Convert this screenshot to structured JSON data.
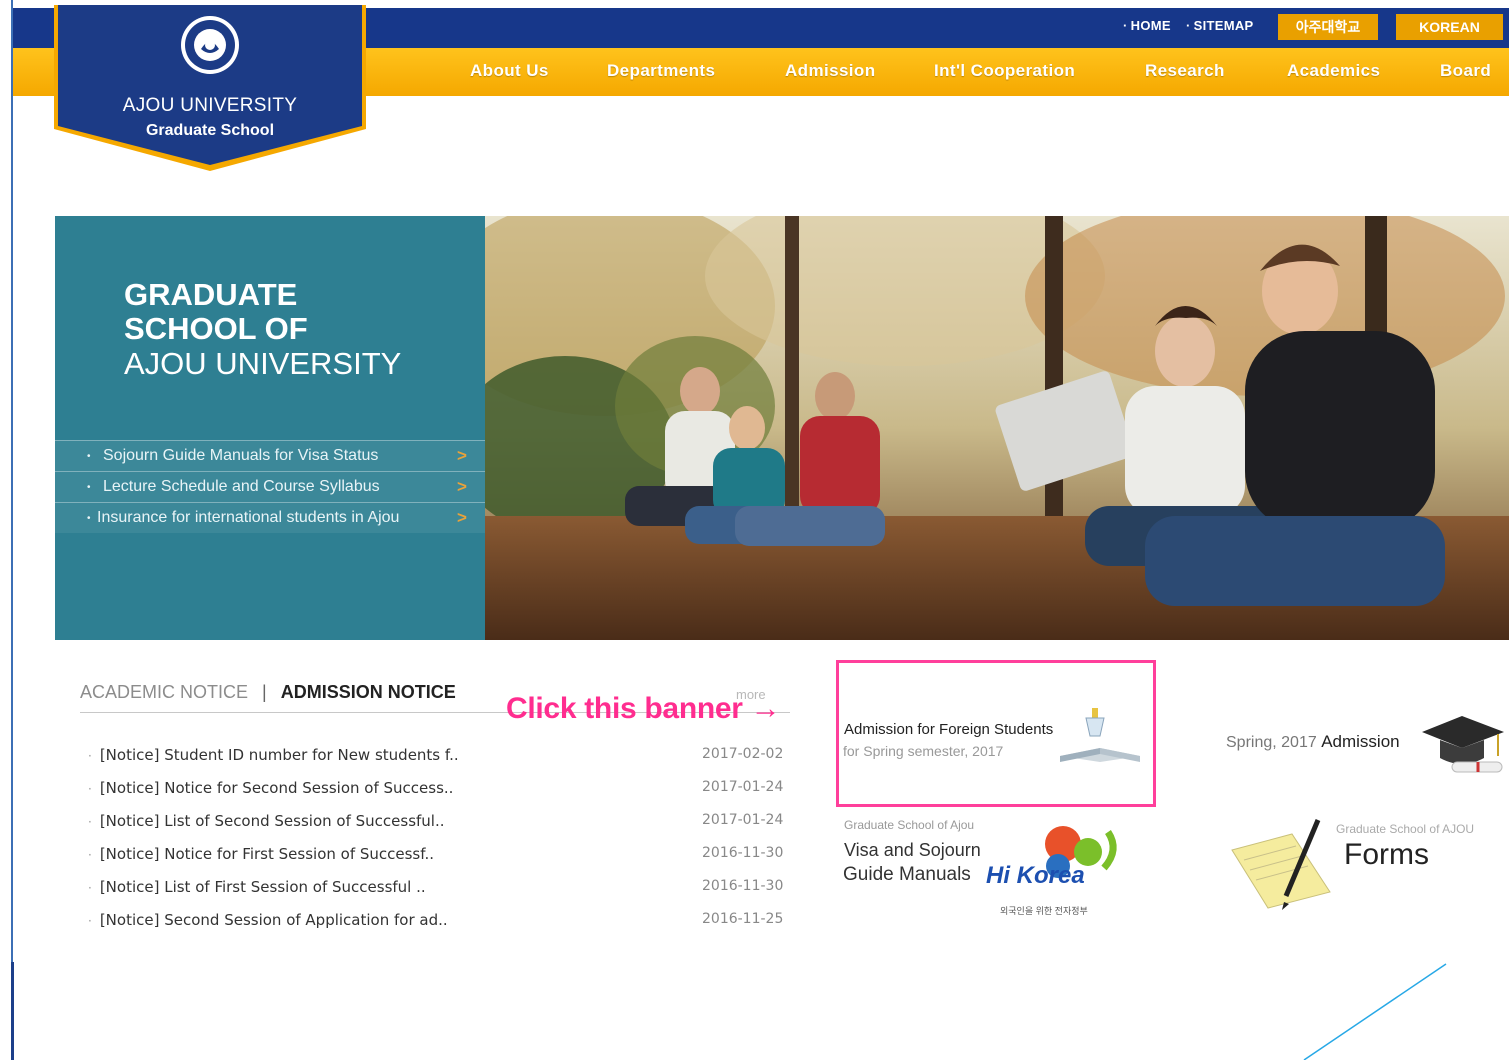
{
  "header": {
    "util_links": [
      {
        "label": "HOME"
      },
      {
        "label": "SITEMAP"
      }
    ],
    "lang_buttons": [
      "아주대학교",
      "KOREAN"
    ],
    "logo": {
      "name": "AJOU UNIVERSITY",
      "subtitle": "Graduate School"
    },
    "nav": [
      "About Us",
      "Departments",
      "Admission",
      "Int'l Cooperation",
      "Research",
      "Academics",
      "Board"
    ]
  },
  "hero": {
    "title_line1": "GRADUATE",
    "title_line2": "SCHOOL OF",
    "title_line3": "AJOU UNIVERSITY",
    "links": [
      "Sojourn Guide Manuals for Visa Status",
      "Lecture Schedule and Course Syllabus",
      "Insurance for international students in Ajou"
    ]
  },
  "notices": {
    "tab_academic": "ACADEMIC NOTICE",
    "separator": "|",
    "tab_admission": "ADMISSION NOTICE",
    "more_label": "more",
    "items": [
      {
        "title": "[Notice] Student ID number for New students f..",
        "date": "2017-02-02"
      },
      {
        "title": "[Notice] Notice for Second Session of Success..",
        "date": "2017-01-24"
      },
      {
        "title": "[Notice] List of Second Session of Successful..",
        "date": "2017-01-24"
      },
      {
        "title": "[Notice] Notice for First Session of Successf..",
        "date": "2016-11-30"
      },
      {
        "title": "[Notice] List of First Session of Successful ..",
        "date": "2016-11-30"
      },
      {
        "title": "[Notice] Second Session of Application for ad..",
        "date": "2016-11-25"
      }
    ]
  },
  "annotation": "Click this banner →",
  "banners": {
    "foreign": {
      "title": "Admission for Foreign Students",
      "subtitle": "for Spring semester, 2017"
    },
    "spring": {
      "prefix": "Spring, 2017 ",
      "emph": "Admission"
    },
    "visa": {
      "small": "Graduate School of Ajou",
      "line1": "Visa and Sojourn",
      "line2": "Guide Manuals",
      "logo_text": "Hi Korea",
      "logo_caption": "외국인을 위한 전자정부"
    },
    "forms": {
      "small": "Graduate School of AJOU",
      "title": "Forms"
    }
  },
  "colors": {
    "navy": "#17378a",
    "gold": "#f5a800",
    "teal": "#2e7f92",
    "highlight": "#ff3f9b"
  }
}
